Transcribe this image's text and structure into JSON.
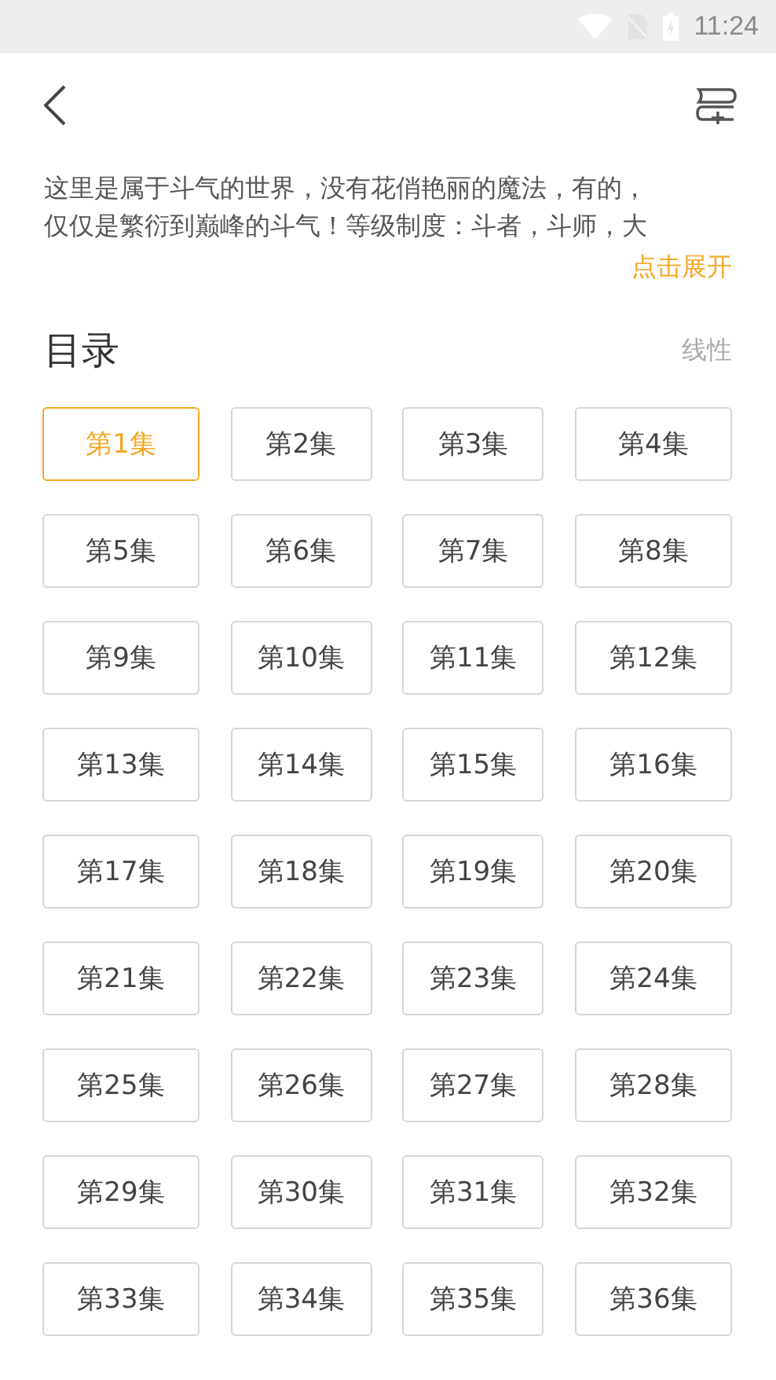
{
  "status_bar": {
    "time": "11:24"
  },
  "description": {
    "lines": [
      "这里是属于斗气的世界，没有花俏艳丽的魔法，有的，",
      "仅仅是繁衍到巅峰的斗气！等级制度：斗者，斗师，大"
    ],
    "expand_link": "点击展开"
  },
  "catalog": {
    "title": "目录",
    "sort_label": "线性",
    "episodes": [
      {
        "label": "第1集",
        "selected": true
      },
      {
        "label": "第2集",
        "selected": false
      },
      {
        "label": "第3集",
        "selected": false
      },
      {
        "label": "第4集",
        "selected": false
      },
      {
        "label": "第5集",
        "selected": false
      },
      {
        "label": "第6集",
        "selected": false
      },
      {
        "label": "第7集",
        "selected": false
      },
      {
        "label": "第8集",
        "selected": false
      },
      {
        "label": "第9集",
        "selected": false
      },
      {
        "label": "第10集",
        "selected": false
      },
      {
        "label": "第11集",
        "selected": false
      },
      {
        "label": "第12集",
        "selected": false
      },
      {
        "label": "第13集",
        "selected": false
      },
      {
        "label": "第14集",
        "selected": false
      },
      {
        "label": "第15集",
        "selected": false
      },
      {
        "label": "第16集",
        "selected": false
      },
      {
        "label": "第17集",
        "selected": false
      },
      {
        "label": "第18集",
        "selected": false
      },
      {
        "label": "第19集",
        "selected": false
      },
      {
        "label": "第20集",
        "selected": false
      },
      {
        "label": "第21集",
        "selected": false
      },
      {
        "label": "第22集",
        "selected": false
      },
      {
        "label": "第23集",
        "selected": false
      },
      {
        "label": "第24集",
        "selected": false
      },
      {
        "label": "第25集",
        "selected": false
      },
      {
        "label": "第26集",
        "selected": false
      },
      {
        "label": "第27集",
        "selected": false
      },
      {
        "label": "第28集",
        "selected": false
      },
      {
        "label": "第29集",
        "selected": false
      },
      {
        "label": "第30集",
        "selected": false
      },
      {
        "label": "第31集",
        "selected": false
      },
      {
        "label": "第32集",
        "selected": false
      },
      {
        "label": "第33集",
        "selected": false
      },
      {
        "label": "第34集",
        "selected": false
      },
      {
        "label": "第35集",
        "selected": false
      },
      {
        "label": "第36集",
        "selected": false
      }
    ]
  }
}
